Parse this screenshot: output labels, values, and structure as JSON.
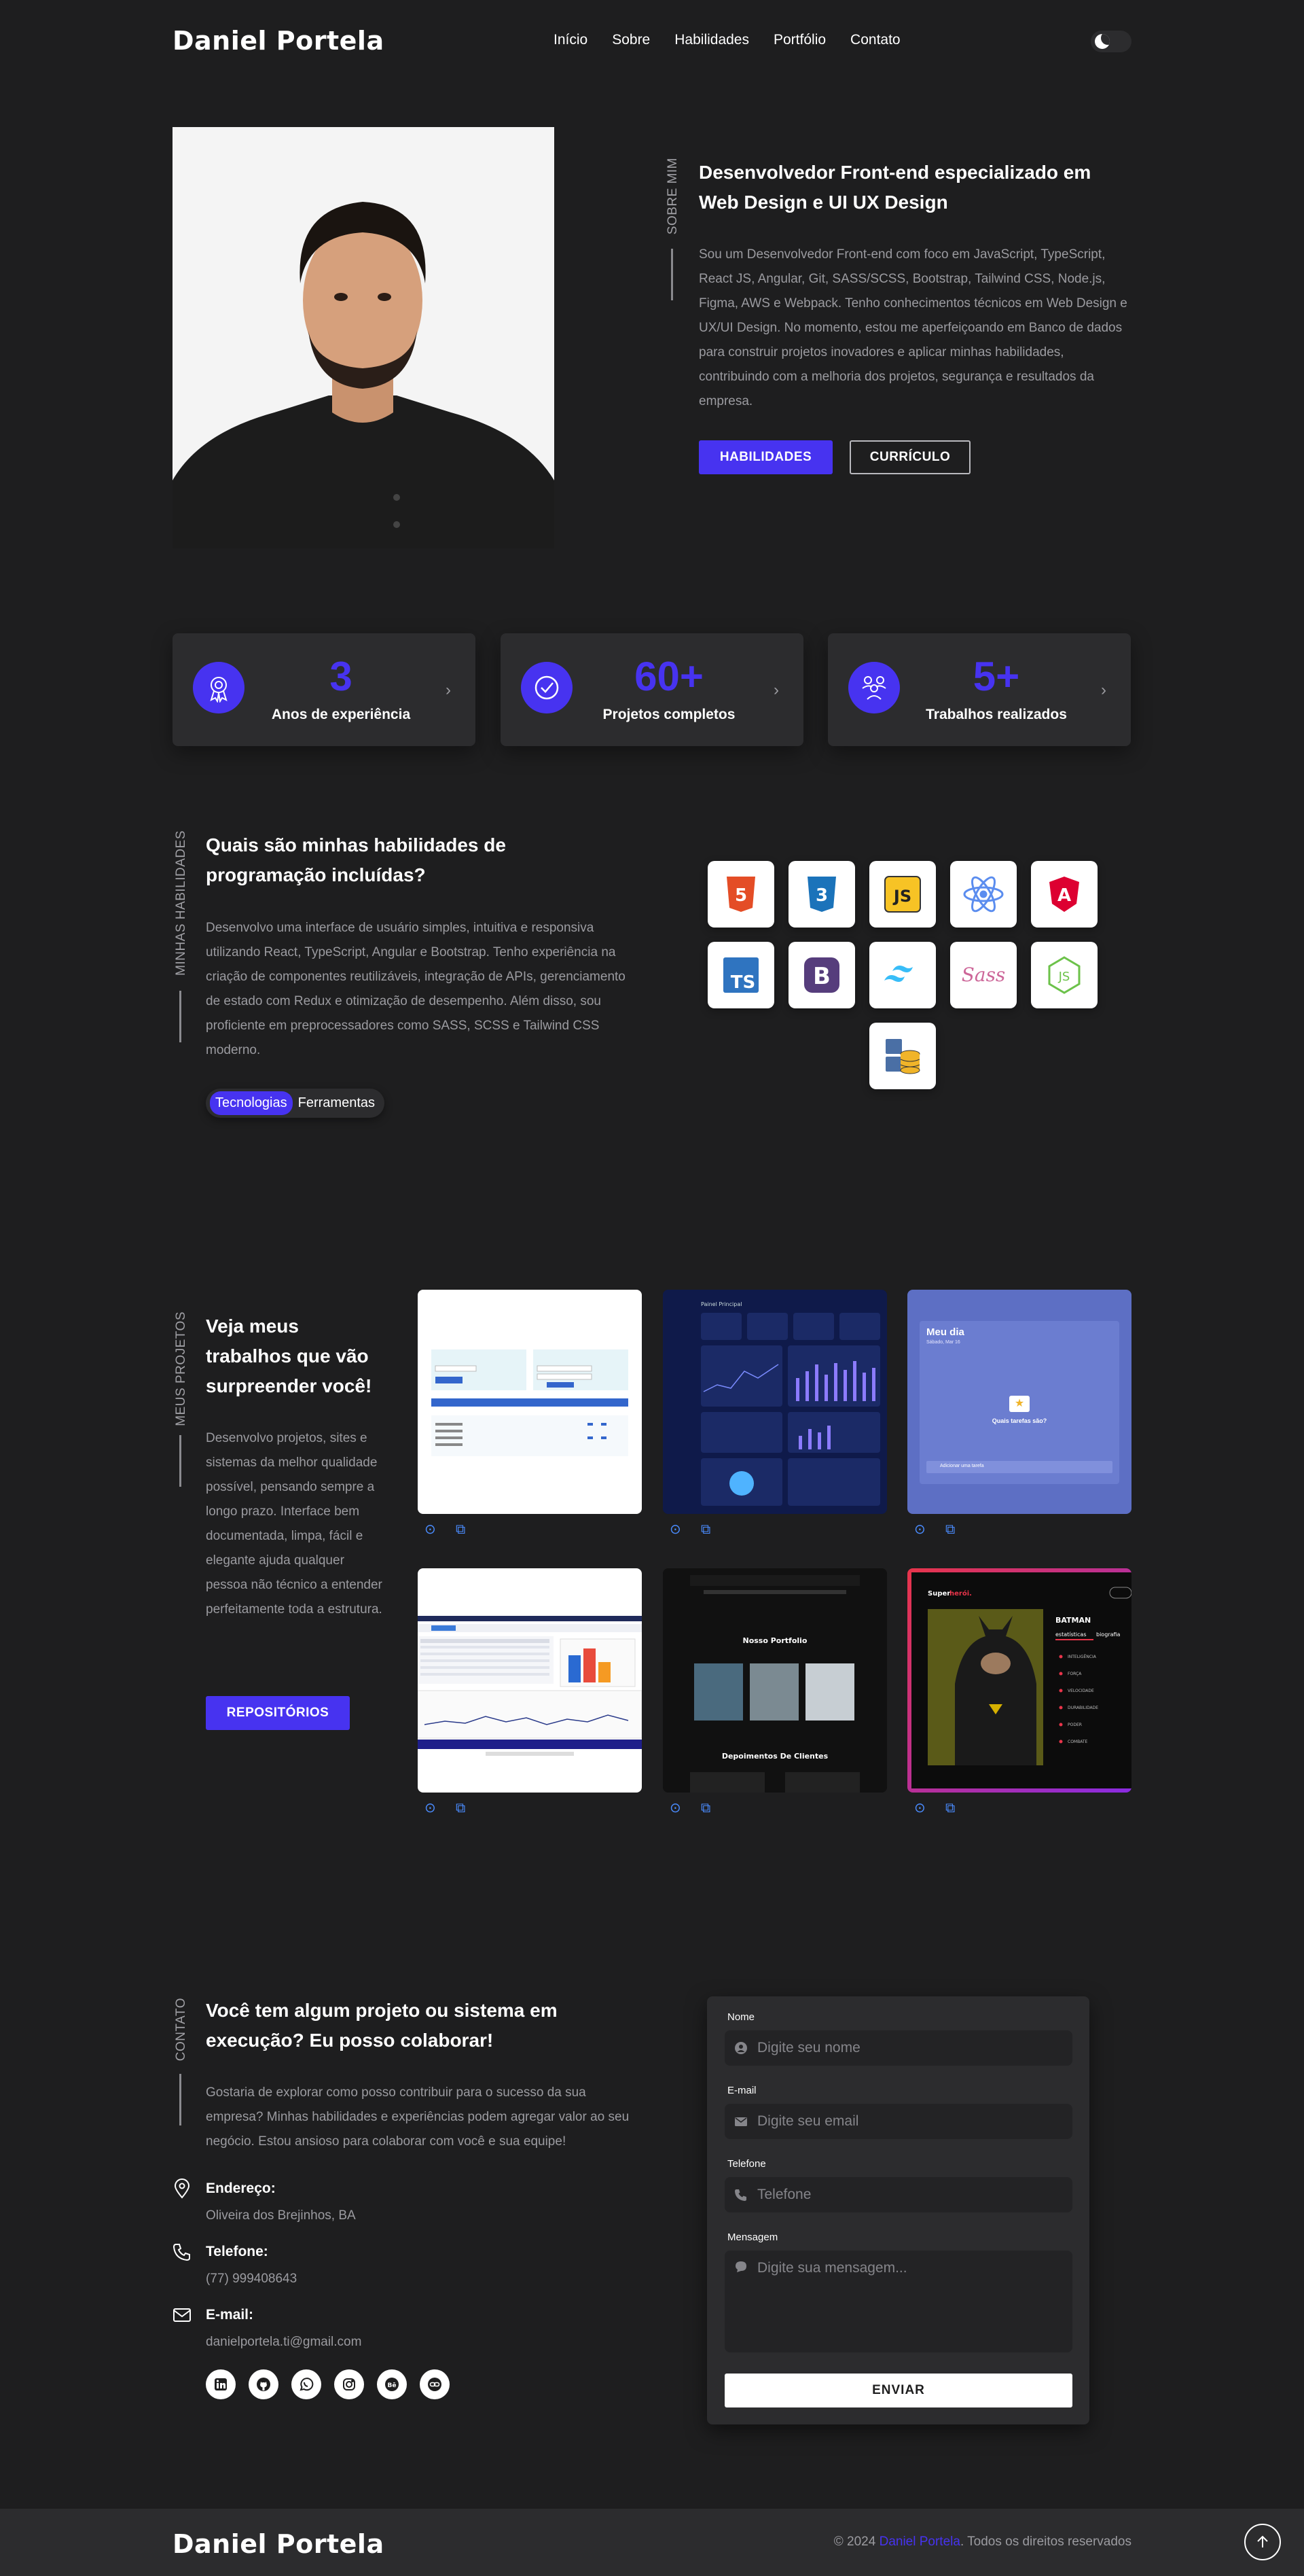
{
  "header": {
    "logo": "Daniel Portela",
    "nav": [
      "Início",
      "Sobre",
      "Habilidades",
      "Portfólio",
      "Contato"
    ]
  },
  "about": {
    "side_label": "SOBRE MIM",
    "title": "Desenvolvedor Front-end especializado em Web Design e UI UX Design",
    "text": "Sou um Desenvolvedor Front-end com foco em JavaScript, TypeScript, React JS, Angular, Git, SASS/SCSS, Bootstrap, Tailwind CSS, Node.js, Figma, AWS e Webpack. Tenho conhecimentos técnicos em Web Design e UX/UI Design. No momento, estou me aperfeiçoando em Banco de dados para construir projetos inovadores e aplicar minhas habilidades, contribuindo com a melhoria dos projetos, segurança e resultados da empresa.",
    "btn_skills": "HABILIDADES",
    "btn_cv": "CURRÍCULO"
  },
  "stats": [
    {
      "number": "3",
      "label": "Anos de experiência",
      "icon": "award-icon"
    },
    {
      "number": "60+",
      "label": "Projetos completos",
      "icon": "check-badge-icon"
    },
    {
      "number": "5+",
      "label": "Trabalhos realizados",
      "icon": "team-icon"
    }
  ],
  "skills": {
    "side_label": "MINHAS HABILIDADES",
    "title": "Quais são minhas habilidades de programação incluídas?",
    "text": "Desenvolvo uma interface de usuário simples, intuitiva e responsiva utilizando React, TypeScript, Angular e Bootstrap. Tenho experiência na criação de componentes reutilizáveis, integração de APIs, gerenciamento de estado com Redux e otimização de desempenho. Além disso, sou proficiente em preprocessadores como SASS, SCSS e Tailwind CSS moderno.",
    "tab_tech": "Tecnologias",
    "tab_tools": "Ferramentas",
    "icons": [
      "html5-icon",
      "css3-icon",
      "javascript-icon",
      "react-icon",
      "angular-icon",
      "typescript-icon",
      "bootstrap-icon",
      "tailwind-icon",
      "sass-icon",
      "nodejs-icon",
      "database-icon"
    ],
    "icon_text": {
      "js": "JS",
      "ts": "TS",
      "bootstrap": "B",
      "sass": "Sass",
      "angular": "A",
      "html": "5",
      "css": "3"
    }
  },
  "projects": {
    "side_label": "MEUS PROJETOS",
    "title": "Veja meus trabalhos que vão surpreender você!",
    "text": "Desenvolvo projetos, sites e sistemas da melhor qualidade possível, pensando sempre a longo prazo. Interface bem documentada, limpa, fácil e elegante ajuda qualquer pessoa não técnico a entender perfeitamente toda a estrutura.",
    "btn_repos": "REPOSITÓRIOS",
    "card3": {
      "title": "Meu dia",
      "subtitle": "Quais tarefas são?",
      "add": "Adicionar uma tarefa"
    },
    "card5": {
      "title": "Nosso Portfolio",
      "section": "Depoimentos De Clientes"
    },
    "card6": {
      "brand_a": "Super",
      "brand_b": "herói.",
      "hero": "BATMAN",
      "tab_a": "estatísticas",
      "tab_b": "biografia",
      "stats": [
        "INTELIGÊNCIA",
        "FORÇA",
        "VELOCIDADE",
        "DURABILIDADE",
        "PODER",
        "COMBATE"
      ]
    },
    "card2": {
      "title": "Painel Principal"
    }
  },
  "contact": {
    "side_label": "CONTATO",
    "title": "Você tem algum projeto ou sistema em execução? Eu posso colaborar!",
    "text": "Gostaria de explorar como posso contribuir para o sucesso da sua empresa? Minhas habilidades e experiências podem agregar valor ao seu negócio. Estou ansioso para colaborar com você e sua equipe!",
    "address_label": "Endereço:",
    "address": "Oliveira dos Brejinhos, BA",
    "phone_label": "Telefone:",
    "phone": "(77) 999408643",
    "email_label": "E-mail:",
    "email": "danielportela.ti@gmail.com",
    "form": {
      "name_label": "Nome",
      "name_ph": "Digite seu nome",
      "email_label": "E-mail",
      "email_ph": "Digite seu email",
      "phone_label": "Telefone",
      "phone_ph": "Telefone",
      "msg_label": "Mensagem",
      "msg_ph": "Digite sua mensagem...",
      "send": "ENVIAR"
    }
  },
  "footer": {
    "logo": "Daniel Portela",
    "copy_a": "© 2024 ",
    "copy_name": "Daniel Portela",
    "copy_b": ". Todos os direitos reservados"
  },
  "colors": {
    "accent": "#4733f0",
    "bg": "#1e1e1f",
    "card": "#2c2c2e"
  }
}
